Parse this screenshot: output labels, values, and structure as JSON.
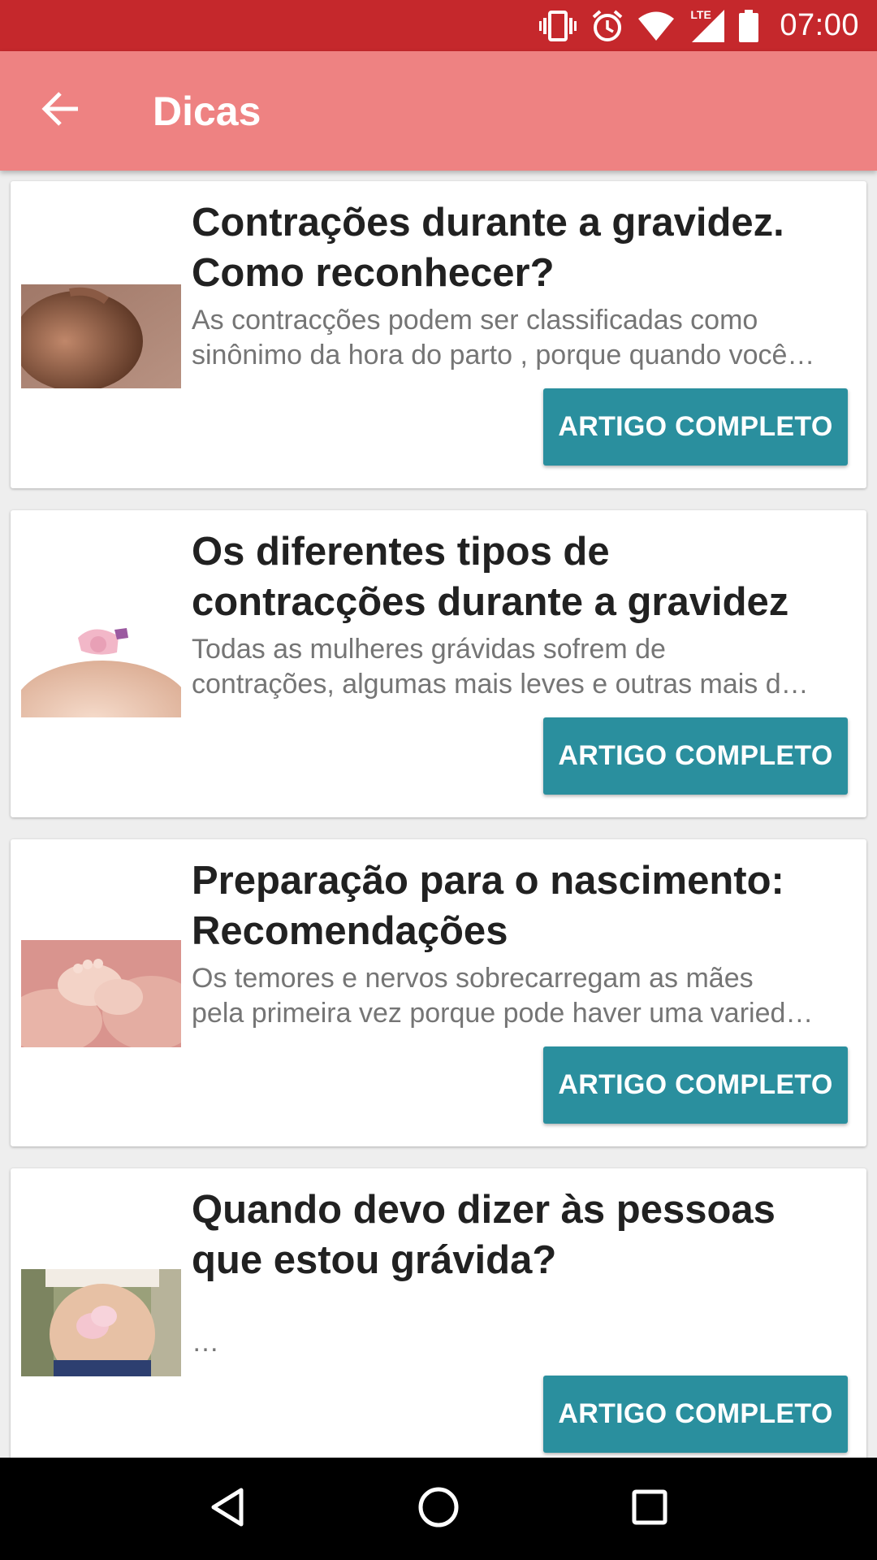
{
  "status_bar": {
    "time": "07:00",
    "network_label": "LTE",
    "icons": [
      "vibrate-icon",
      "alarm-icon",
      "wifi-icon",
      "lte-signal-icon",
      "battery-icon"
    ]
  },
  "app_bar": {
    "title": "Dicas",
    "back_icon": "arrow-back-icon"
  },
  "articles": [
    {
      "title_line1": "Contrações durante a gravidez.",
      "title_line2": "Como reconhecer?",
      "desc_line1": "As contracções podem ser classificadas como",
      "desc_line2": "sinônimo da hora do parto , porque quando você…",
      "button_label": "ARTIGO COMPLETO",
      "image": "pregnant-belly-photo"
    },
    {
      "title_line1": "Os diferentes tipos de",
      "title_line2": "contracções durante a gravidez",
      "desc_line1": "Todas as mulheres grávidas sofrem de",
      "desc_line2": "contrações, algumas mais leves e outras mais d…",
      "button_label": "ARTIGO COMPLETO",
      "image": "belly-with-baby-shoes-photo"
    },
    {
      "title_line1": "Preparação para o nascimento:",
      "title_line2": "Recomendações",
      "desc_line1": "Os temores e nervos sobrecarregam as mães",
      "desc_line2": "pela primeira vez porque pode haver uma varied…",
      "button_label": "ARTIGO COMPLETO",
      "image": "baby-feet-in-hands-photo"
    },
    {
      "title_line1": "Quando devo dizer às pessoas",
      "title_line2": "que estou grávida?",
      "desc_line1": "",
      "desc_line2": "…",
      "button_label": "ARTIGO COMPLETO",
      "image": "belly-with-booties-photo"
    }
  ],
  "colors": {
    "status_bar": "#c5282c",
    "app_bar": "#ee8282",
    "button": "#2a8f9e",
    "background": "#eeeeee"
  },
  "nav_bar": {
    "icons": [
      "nav-back-icon",
      "nav-home-icon",
      "nav-recents-icon"
    ]
  }
}
